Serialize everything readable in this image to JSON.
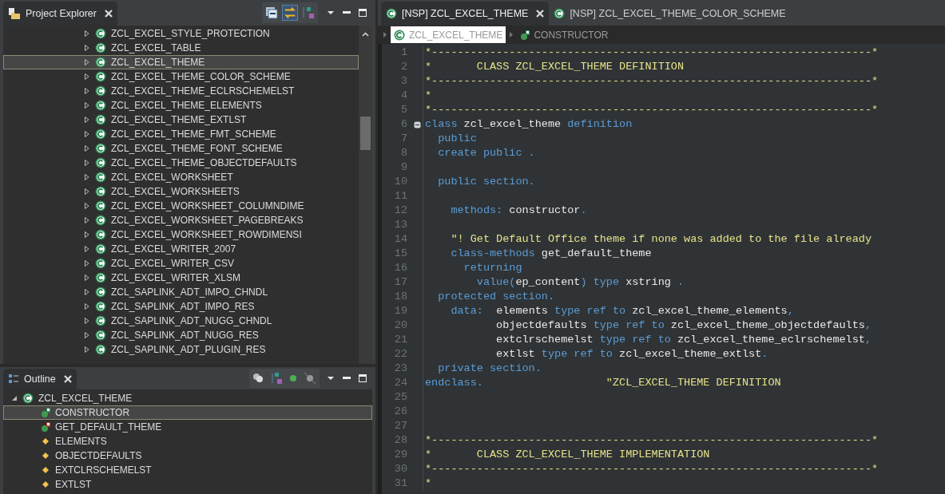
{
  "project_explorer": {
    "title": "Project Explorer",
    "items": [
      {
        "label": "ZCL_EXCEL_STYLE_PROTECTION",
        "selected": false
      },
      {
        "label": "ZCL_EXCEL_TABLE",
        "selected": false
      },
      {
        "label": "ZCL_EXCEL_THEME",
        "selected": true
      },
      {
        "label": "ZCL_EXCEL_THEME_COLOR_SCHEME",
        "selected": false
      },
      {
        "label": "ZCL_EXCEL_THEME_ECLRSCHEMELST",
        "selected": false
      },
      {
        "label": "ZCL_EXCEL_THEME_ELEMENTS",
        "selected": false
      },
      {
        "label": "ZCL_EXCEL_THEME_EXTLST",
        "selected": false
      },
      {
        "label": "ZCL_EXCEL_THEME_FMT_SCHEME",
        "selected": false
      },
      {
        "label": "ZCL_EXCEL_THEME_FONT_SCHEME",
        "selected": false
      },
      {
        "label": "ZCL_EXCEL_THEME_OBJECTDEFAULTS",
        "selected": false
      },
      {
        "label": "ZCL_EXCEL_WORKSHEET",
        "selected": false
      },
      {
        "label": "ZCL_EXCEL_WORKSHEETS",
        "selected": false
      },
      {
        "label": "ZCL_EXCEL_WORKSHEET_COLUMNDIME",
        "selected": false
      },
      {
        "label": "ZCL_EXCEL_WORKSHEET_PAGEBREAKS",
        "selected": false
      },
      {
        "label": "ZCL_EXCEL_WORKSHEET_ROWDIMENSI",
        "selected": false
      },
      {
        "label": "ZCL_EXCEL_WRITER_2007",
        "selected": false
      },
      {
        "label": "ZCL_EXCEL_WRITER_CSV",
        "selected": false
      },
      {
        "label": "ZCL_EXCEL_WRITER_XLSM",
        "selected": false
      },
      {
        "label": "ZCL_SAPLINK_ADT_IMPO_CHNDL",
        "selected": false
      },
      {
        "label": "ZCL_SAPLINK_ADT_IMPO_RES",
        "selected": false
      },
      {
        "label": "ZCL_SAPLINK_ADT_NUGG_CHNDL",
        "selected": false
      },
      {
        "label": "ZCL_SAPLINK_ADT_NUGG_RES",
        "selected": false
      },
      {
        "label": "ZCL_SAPLINK_ADT_PLUGIN_RES",
        "selected": false
      }
    ]
  },
  "outline": {
    "title": "Outline",
    "root": {
      "label": "ZCL_EXCEL_THEME",
      "expanded": true,
      "children": [
        {
          "label": "CONSTRUCTOR",
          "kind": "method",
          "selected": true
        },
        {
          "label": "GET_DEFAULT_THEME",
          "kind": "static-method",
          "selected": false
        },
        {
          "label": "ELEMENTS",
          "kind": "attribute",
          "selected": false
        },
        {
          "label": "OBJECTDEFAULTS",
          "kind": "attribute",
          "selected": false
        },
        {
          "label": "EXTCLRSCHEMELST",
          "kind": "attribute",
          "selected": false
        },
        {
          "label": "EXTLST",
          "kind": "attribute",
          "selected": false
        }
      ]
    }
  },
  "editor": {
    "tabs": [
      {
        "label": "[NSP] ZCL_EXCEL_THEME",
        "selected": true
      },
      {
        "label": "[NSP] ZCL_EXCEL_THEME_COLOR_SCHEME",
        "selected": false
      }
    ],
    "breadcrumb": [
      {
        "label": "ZCL_EXCEL_THEME",
        "kind": "class"
      },
      {
        "label": "CONSTRUCTOR",
        "kind": "method"
      }
    ],
    "lines": [
      {
        "number": "1",
        "foldable": false,
        "tokens": [
          {
            "kind": "comment",
            "text": "*--------------------------------------------------------------------*"
          }
        ]
      },
      {
        "number": "2",
        "foldable": false,
        "tokens": [
          {
            "kind": "comment",
            "text": "*       CLASS ZCL_EXCEL_THEME DEFINITION"
          }
        ]
      },
      {
        "number": "3",
        "foldable": false,
        "tokens": [
          {
            "kind": "comment",
            "text": "*--------------------------------------------------------------------*"
          }
        ]
      },
      {
        "number": "4",
        "foldable": false,
        "tokens": [
          {
            "kind": "comment",
            "text": "*"
          }
        ]
      },
      {
        "number": "5",
        "foldable": false,
        "tokens": [
          {
            "kind": "comment",
            "text": "*--------------------------------------------------------------------*"
          }
        ]
      },
      {
        "number": "6",
        "foldable": true,
        "tokens": [
          {
            "kind": "keyword",
            "text": "class "
          },
          {
            "kind": "identifier",
            "text": "zcl_excel_theme "
          },
          {
            "kind": "keyword",
            "text": "definition"
          }
        ]
      },
      {
        "number": "7",
        "foldable": false,
        "tokens": [
          {
            "kind": "keyword",
            "text": "  public"
          }
        ]
      },
      {
        "number": "8",
        "foldable": false,
        "tokens": [
          {
            "kind": "keyword",
            "text": "  create public ."
          }
        ]
      },
      {
        "number": "9",
        "foldable": false
      },
      {
        "number": "10",
        "foldable": false,
        "tokens": [
          {
            "kind": "keyword",
            "text": "  public section."
          }
        ]
      },
      {
        "number": "11",
        "foldable": false
      },
      {
        "number": "12",
        "foldable": false,
        "tokens": [
          {
            "kind": "keyword",
            "text": "    methods: "
          },
          {
            "kind": "identifier",
            "text": "constructor"
          },
          {
            "kind": "keyword",
            "text": "."
          }
        ]
      },
      {
        "number": "13",
        "foldable": false
      },
      {
        "number": "14",
        "foldable": false,
        "tokens": [
          {
            "kind": "comment",
            "text": "    \"! Get Default Office theme if none was added to the file already"
          }
        ]
      },
      {
        "number": "15",
        "foldable": false,
        "tokens": [
          {
            "kind": "keyword",
            "text": "    class-methods "
          },
          {
            "kind": "identifier",
            "text": "get_default_theme"
          }
        ]
      },
      {
        "number": "16",
        "foldable": false,
        "tokens": [
          {
            "kind": "keyword",
            "text": "      returning"
          }
        ]
      },
      {
        "number": "17",
        "foldable": false,
        "tokens": [
          {
            "kind": "keyword",
            "text": "        value("
          },
          {
            "kind": "identifier",
            "text": "ep_content"
          },
          {
            "kind": "keyword",
            "text": ") type "
          },
          {
            "kind": "identifier",
            "text": "xstring "
          },
          {
            "kind": "keyword",
            "text": "."
          }
        ]
      },
      {
        "number": "18",
        "foldable": false,
        "tokens": [
          {
            "kind": "keyword",
            "text": "  protected section."
          }
        ]
      },
      {
        "number": "19",
        "foldable": false,
        "tokens": [
          {
            "kind": "keyword",
            "text": "    data:  "
          },
          {
            "kind": "identifier",
            "text": "elements "
          },
          {
            "kind": "keyword",
            "text": "type ref to "
          },
          {
            "kind": "identifier",
            "text": "zcl_excel_theme_elements"
          },
          {
            "kind": "keyword",
            "text": ","
          }
        ]
      },
      {
        "number": "20",
        "foldable": false,
        "tokens": [
          {
            "kind": "identifier",
            "text": "           objectdefaults "
          },
          {
            "kind": "keyword",
            "text": "type ref to "
          },
          {
            "kind": "identifier",
            "text": "zcl_excel_theme_objectdefaults"
          },
          {
            "kind": "keyword",
            "text": ","
          }
        ]
      },
      {
        "number": "21",
        "foldable": false,
        "tokens": [
          {
            "kind": "identifier",
            "text": "           extclrschemelst "
          },
          {
            "kind": "keyword",
            "text": "type ref to "
          },
          {
            "kind": "identifier",
            "text": "zcl_excel_theme_eclrschemelst"
          },
          {
            "kind": "keyword",
            "text": ","
          }
        ]
      },
      {
        "number": "22",
        "foldable": false,
        "tokens": [
          {
            "kind": "identifier",
            "text": "           extlst "
          },
          {
            "kind": "keyword",
            "text": "type ref to "
          },
          {
            "kind": "identifier",
            "text": "zcl_excel_theme_extlst"
          },
          {
            "kind": "keyword",
            "text": "."
          }
        ]
      },
      {
        "number": "23",
        "foldable": false,
        "tokens": [
          {
            "kind": "keyword",
            "text": "  private section."
          }
        ]
      },
      {
        "number": "24",
        "foldable": false,
        "tokens": [
          {
            "kind": "keyword",
            "text": "endclass."
          },
          {
            "kind": "comment",
            "text": "                   \"ZCL_EXCEL_THEME DEFINITION"
          }
        ]
      },
      {
        "number": "25",
        "foldable": false
      },
      {
        "number": "26",
        "foldable": false
      },
      {
        "number": "27",
        "foldable": false
      },
      {
        "number": "28",
        "foldable": false,
        "tokens": [
          {
            "kind": "comment",
            "text": "*--------------------------------------------------------------------*"
          }
        ]
      },
      {
        "number": "29",
        "foldable": false,
        "tokens": [
          {
            "kind": "comment",
            "text": "*       CLASS ZCL_EXCEL_THEME IMPLEMENTATION"
          }
        ]
      },
      {
        "number": "30",
        "foldable": false,
        "tokens": [
          {
            "kind": "comment",
            "text": "*--------------------------------------------------------------------*"
          }
        ]
      },
      {
        "number": "31",
        "foldable": false,
        "tokens": [
          {
            "kind": "comment",
            "text": "*"
          }
        ]
      }
    ]
  }
}
